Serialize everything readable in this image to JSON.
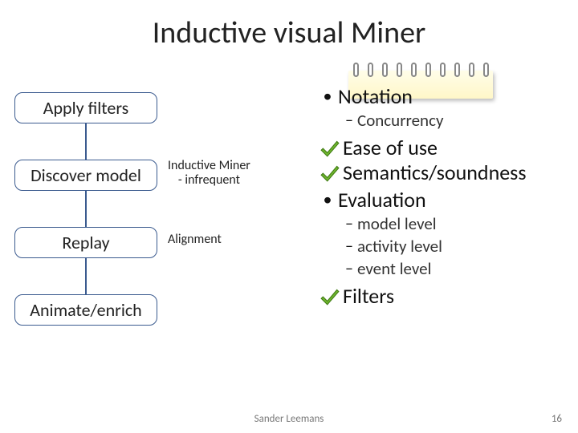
{
  "title": "Inductive visual Miner",
  "flow": {
    "steps": [
      {
        "label": "Apply filters",
        "annotation": ""
      },
      {
        "label": "Discover model",
        "annotation": "Inductive Miner\n- infrequent"
      },
      {
        "label": "Replay",
        "annotation": "Alignment"
      },
      {
        "label": "Animate/enrich",
        "annotation": ""
      }
    ]
  },
  "bullets": {
    "notation": {
      "label": "Notation",
      "sub": [
        "Concurrency"
      ]
    },
    "checked1": "Ease of use",
    "checked2": "Semantics/soundness",
    "evaluation": {
      "label": "Evaluation",
      "sub": [
        "model level",
        "activity level",
        "event level"
      ]
    },
    "checked3": "Filters"
  },
  "footer": {
    "author": "Sander Leemans",
    "page": "16"
  },
  "colors": {
    "box_border": "#3b5b8f",
    "check_fill": "#6fb52e",
    "check_dark": "#3e7a12"
  }
}
